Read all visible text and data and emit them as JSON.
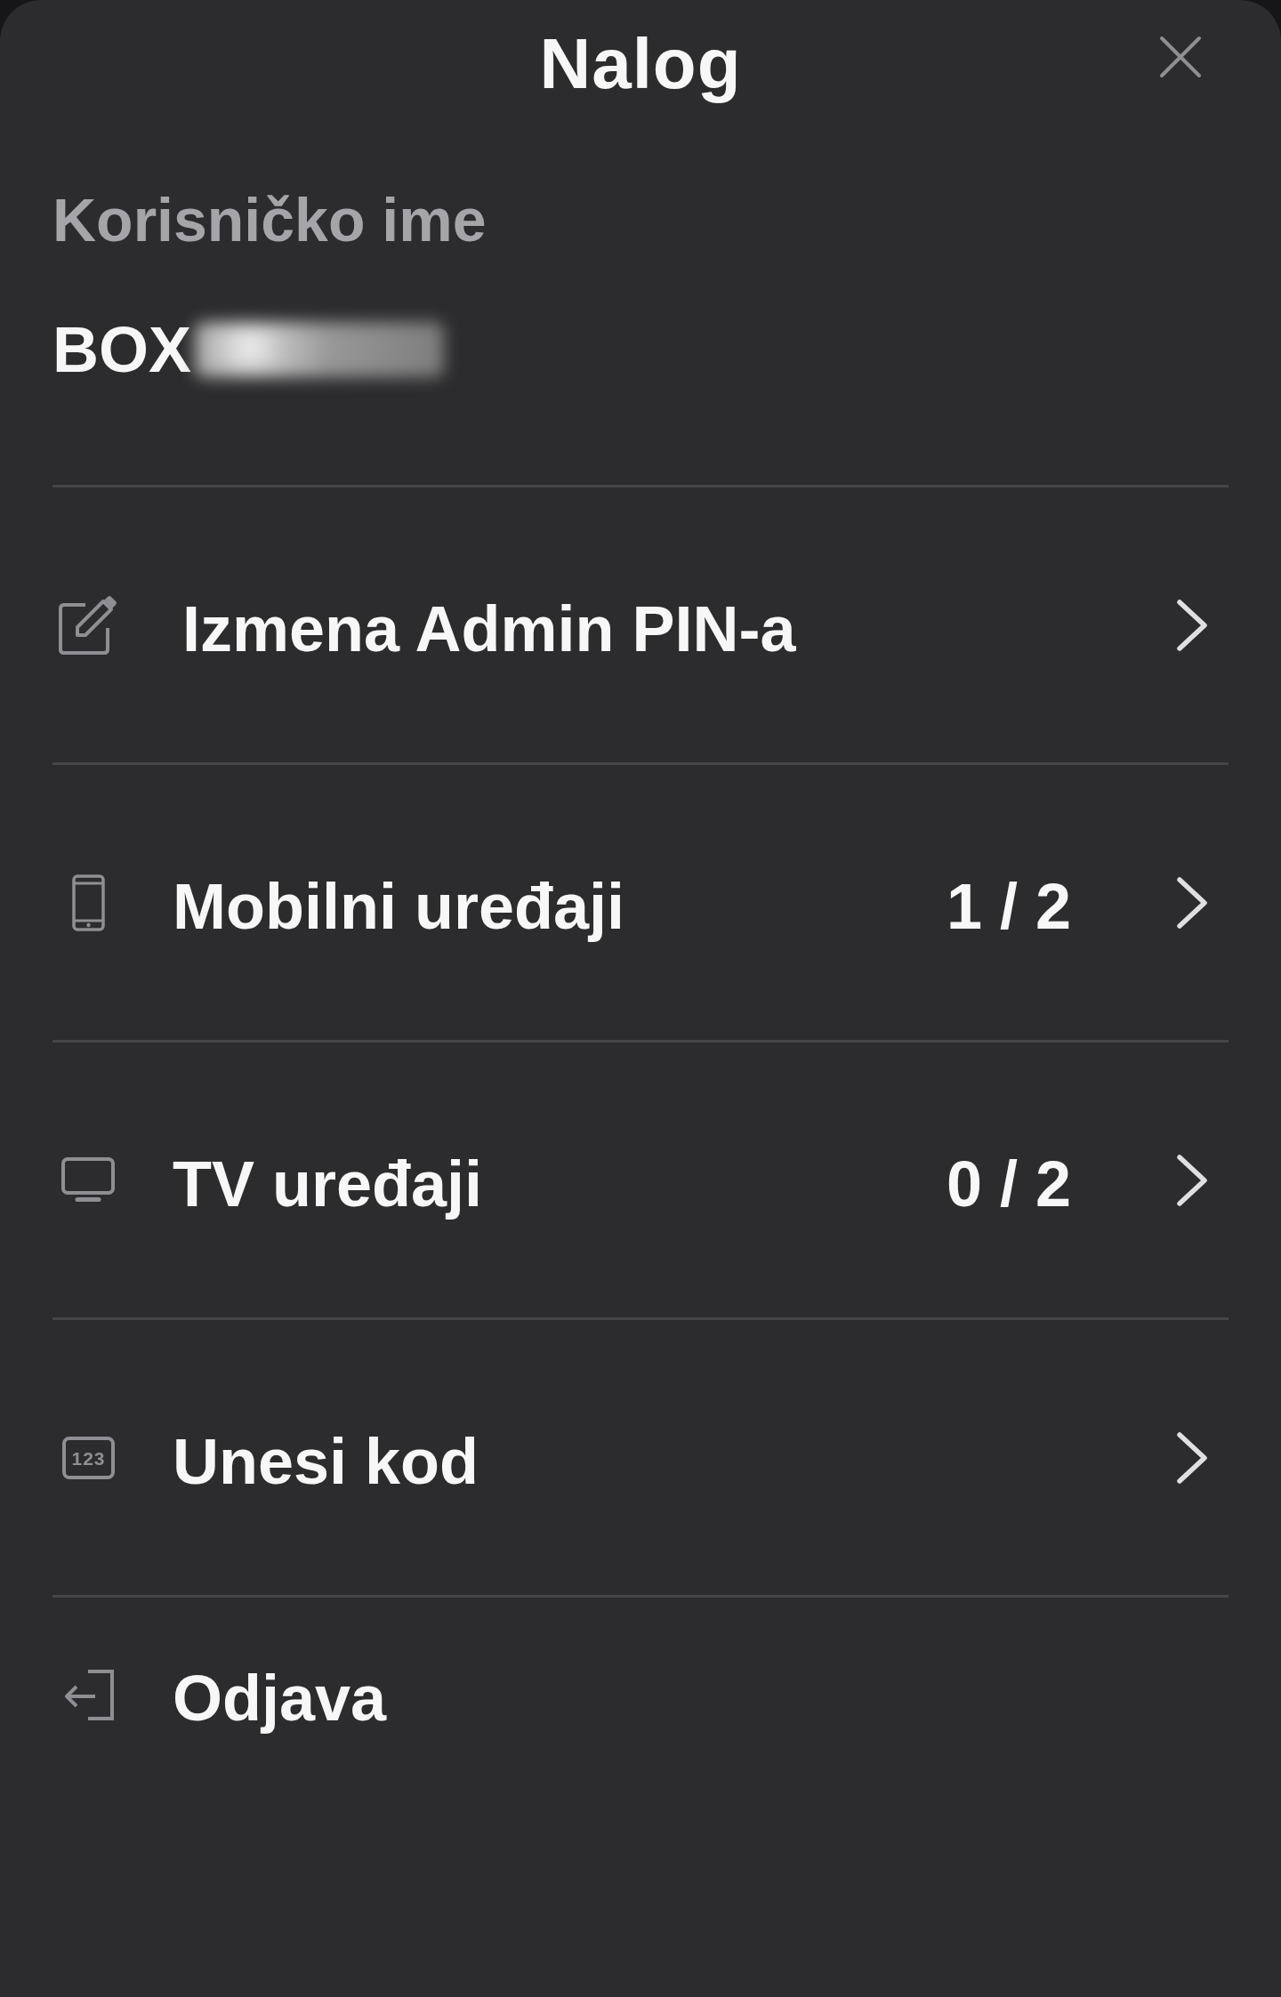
{
  "header": {
    "title": "Nalog"
  },
  "account": {
    "label": "Korisničko ime",
    "username": "BOX"
  },
  "menu": [
    {
      "kind": "edit",
      "label": "Izmena Admin PIN-a",
      "chevron": true
    },
    {
      "kind": "mobile",
      "label": "Mobilni uređaji",
      "count": "1 / 2",
      "chevron": true
    },
    {
      "kind": "tv",
      "label": "TV uređaji",
      "count": "0 / 2",
      "chevron": true
    },
    {
      "kind": "code",
      "label": "Unesi kod",
      "icon_text": "123",
      "chevron": true
    },
    {
      "kind": "logout",
      "label": "Odjava",
      "chevron": false
    }
  ]
}
